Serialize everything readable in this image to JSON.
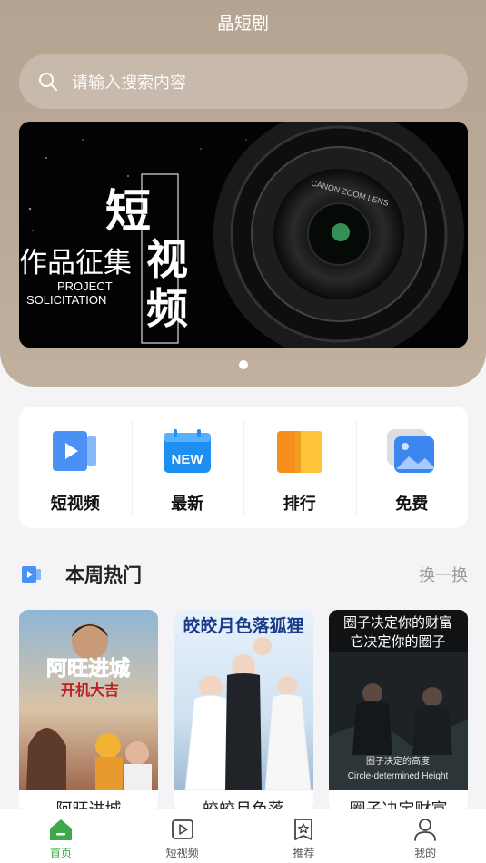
{
  "app": {
    "title": "晶短剧"
  },
  "search": {
    "placeholder": "请输入搜索内容"
  },
  "banner": {
    "line_short": "短",
    "line_video": "视",
    "line_freq": "频",
    "line_collect": "作品征集",
    "project": "PROJECT",
    "solicitation": "SOLICITATION",
    "lens_text": "CANON ZOOM LENS"
  },
  "categories": [
    {
      "label": "短视频",
      "icon": "video-icon",
      "color": "#4a90f5"
    },
    {
      "label": "最新",
      "icon": "new-calendar-icon",
      "color": "#1e8ef0"
    },
    {
      "label": "排行",
      "icon": "ranking-book-icon",
      "color": "#f7a21b"
    },
    {
      "label": "免费",
      "icon": "free-image-icon",
      "color": "#3c86f0"
    }
  ],
  "weekly": {
    "title": "本周热门",
    "refresh_label": "换一换"
  },
  "posters": [
    {
      "title": "阿旺进城",
      "overlay_title": "阿旺进城",
      "overlay_sub": "开机大吉"
    },
    {
      "title": "皎皎月色落",
      "overlay_title": "皎皎月色落狐狸"
    },
    {
      "title": "圈子决定财富",
      "overlay_line1": "圈子决定你的财富",
      "overlay_line2": "它决定你的圈子",
      "caption_cn": "圈子决定的高度",
      "caption_en": "Circle-determined Height"
    }
  ],
  "tabs": [
    {
      "label": "首页",
      "icon": "home-icon",
      "active": true
    },
    {
      "label": "短视频",
      "icon": "play-square-icon",
      "active": false
    },
    {
      "label": "推荐",
      "icon": "star-bookmark-icon",
      "active": false
    },
    {
      "label": "我的",
      "icon": "person-icon",
      "active": false
    }
  ],
  "colors": {
    "accent": "#3ea84a",
    "header": "#b6a493",
    "muted": "#9a9a9a"
  }
}
